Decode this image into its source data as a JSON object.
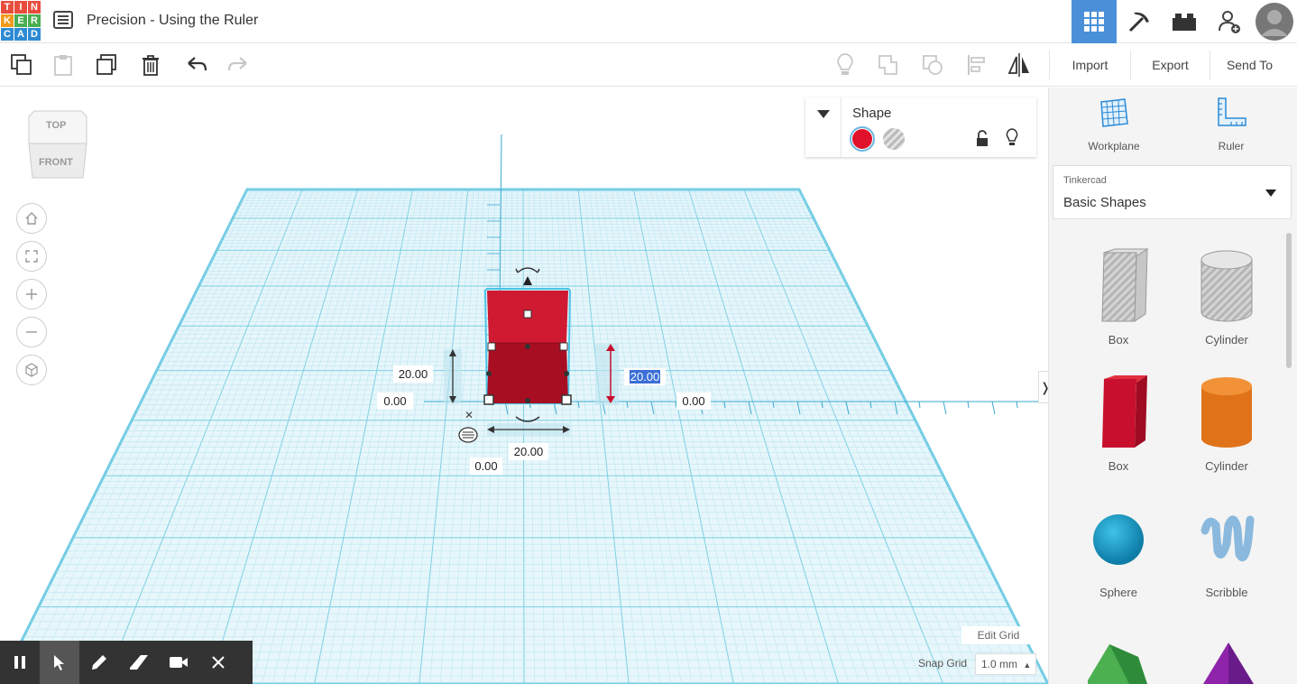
{
  "app": {
    "logo_letters": [
      "T",
      "I",
      "N",
      "K",
      "E",
      "R",
      "C",
      "A",
      "D"
    ],
    "logo_colors": [
      "#e84c3d",
      "#e84c3d",
      "#e84c3d",
      "#f19a1b",
      "#4aae51",
      "#4aae51",
      "#2e8bd3",
      "#2e8bd3",
      "#2e8bd3"
    ],
    "title": "Precision - Using the Ruler"
  },
  "top_icons": [
    "grid-view-icon",
    "pickaxe-icon",
    "brick-icon",
    "add-user-icon",
    "avatar"
  ],
  "toolbar": {
    "import": "Import",
    "export": "Export",
    "send_to": "Send To"
  },
  "viewcube": {
    "top": "TOP",
    "front": "FRONT"
  },
  "shape_panel": {
    "title": "Shape",
    "solid_color": "#e0112b"
  },
  "tools": {
    "workplane": "Workplane",
    "ruler": "Ruler"
  },
  "library": {
    "provider": "Tinkercad",
    "selected": "Basic Shapes",
    "items": [
      {
        "label": "Box"
      },
      {
        "label": "Cylinder"
      },
      {
        "label": "Box"
      },
      {
        "label": "Cylinder"
      },
      {
        "label": "Sphere"
      },
      {
        "label": "Scribble"
      }
    ]
  },
  "dimensions": {
    "height_left": "20.00",
    "elev_left": "0.00",
    "height_right": "20.00",
    "x_right": "0.00",
    "width_bottom": "20.00",
    "y_bottom": "0.00"
  },
  "grid": {
    "edit_grid": "Edit Grid",
    "snap_label": "Snap Grid",
    "snap_value": "1.0 mm"
  },
  "colors": {
    "accent": "#4a90d9",
    "grid": "#a9dde9",
    "shape": "#c8102e"
  }
}
